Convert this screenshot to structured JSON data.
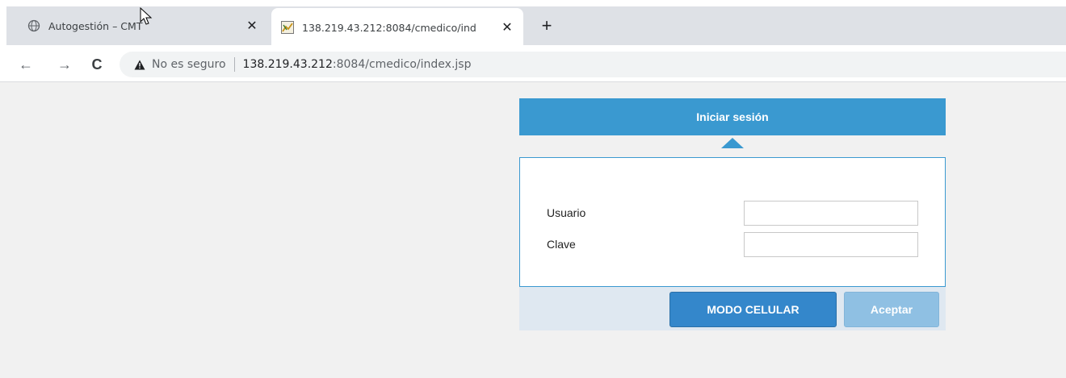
{
  "browser": {
    "tabs": [
      {
        "title": "Autogestión – CMT",
        "icon": "globe-icon",
        "active": false
      },
      {
        "title": "138.219.43.212:8084/cmedico/ind",
        "icon": "site-favicon",
        "active": true
      }
    ],
    "new_tab_symbol": "+",
    "close_symbol": "✕",
    "nav": {
      "back": "←",
      "forward": "→",
      "reload": "C"
    },
    "address": {
      "security_label": "No es seguro",
      "host": "138.219.43.212",
      "path": ":8084/cmedico/index.jsp"
    }
  },
  "login": {
    "header": "Iniciar sesión",
    "fields": [
      {
        "label": "Usuario",
        "value": ""
      },
      {
        "label": "Clave",
        "value": ""
      }
    ],
    "buttons": {
      "mobile_mode": "MODO CELULAR",
      "accept": "Aceptar"
    }
  },
  "colors": {
    "accent": "#3a99d0",
    "button_primary": "#3487cb",
    "button_disabled": "#8fc0e3",
    "footer_bg": "#dfe8f1"
  }
}
